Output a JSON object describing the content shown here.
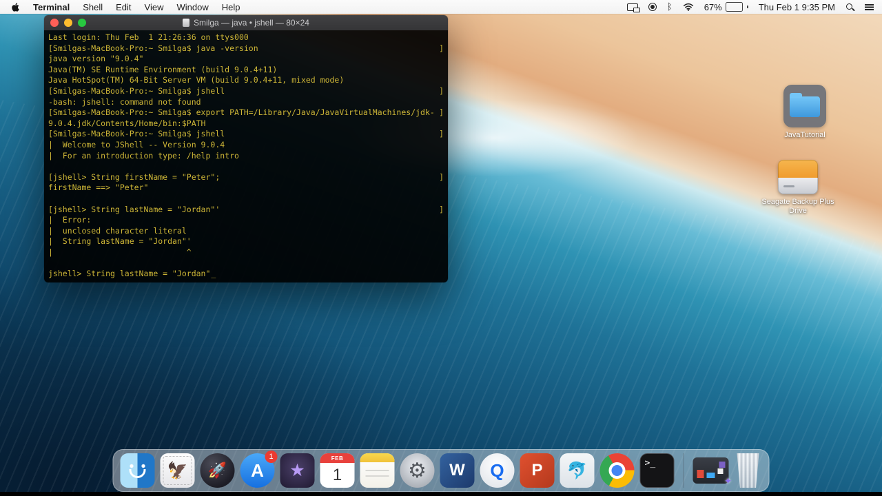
{
  "menu_bar": {
    "app_name": "Terminal",
    "items": [
      "Shell",
      "Edit",
      "View",
      "Window",
      "Help"
    ],
    "battery": "67%",
    "clock": "Thu Feb 1  9:35 PM"
  },
  "terminal": {
    "title": "Smilga — java • jshell — 80×24",
    "lines": [
      {
        "text": "Last login: Thu Feb  1 21:26:36 on ttys000"
      },
      {
        "text": "[Smilgas-MacBook-Pro:~ Smilga$ java -version",
        "mark": "]"
      },
      {
        "text": "java version \"9.0.4\""
      },
      {
        "text": "Java(TM) SE Runtime Environment (build 9.0.4+11)"
      },
      {
        "text": "Java HotSpot(TM) 64-Bit Server VM (build 9.0.4+11, mixed mode)"
      },
      {
        "text": "[Smilgas-MacBook-Pro:~ Smilga$ jshell",
        "mark": "]"
      },
      {
        "text": "-bash: jshell: command not found"
      },
      {
        "text": "[Smilgas-MacBook-Pro:~ Smilga$ export PATH=/Library/Java/JavaVirtualMachines/jdk-",
        "mark": "]"
      },
      {
        "text": "9.0.4.jdk/Contents/Home/bin:$PATH"
      },
      {
        "text": "[Smilgas-MacBook-Pro:~ Smilga$ jshell",
        "mark": "]"
      },
      {
        "text": "|  Welcome to JShell -- Version 9.0.4"
      },
      {
        "text": "|  For an introduction type: /help intro"
      },
      {
        "text": ""
      },
      {
        "text": "[jshell> String firstName = \"Peter\";",
        "mark": "]"
      },
      {
        "text": "firstName ==> \"Peter\""
      },
      {
        "text": ""
      },
      {
        "text": "[jshell> String lastName = \"Jordan\"'",
        "mark": "]"
      },
      {
        "text": "|  Error:"
      },
      {
        "text": "|  unclosed character literal"
      },
      {
        "text": "|  String lastName = \"Jordan\"'"
      },
      {
        "text": "|                            ^"
      },
      {
        "text": ""
      },
      {
        "text": "jshell> String lastName = \"Jordan\"",
        "cursor": true
      }
    ]
  },
  "desktop_icons": [
    {
      "name": "javatutorial-folder",
      "type": "folder",
      "label": "JavaTutorial"
    },
    {
      "name": "seagate-drive",
      "type": "drive",
      "label": "Seagate Backup Plus Drive"
    }
  ],
  "dock": {
    "items": [
      {
        "name": "finder",
        "label": "Finder"
      },
      {
        "name": "mail",
        "label": "Mail",
        "glyph": "🦅"
      },
      {
        "name": "launchpad",
        "label": "Launchpad",
        "glyph": "🚀"
      },
      {
        "name": "appstore",
        "label": "App Store",
        "text": "A",
        "badge": "1"
      },
      {
        "name": "imovie",
        "label": "iMovie",
        "text": "★"
      },
      {
        "name": "calendar",
        "label": "Calendar",
        "month": "FEB",
        "day": "1"
      },
      {
        "name": "notes",
        "label": "Notes"
      },
      {
        "name": "system-preferences",
        "label": "System Preferences",
        "glyph": "⚙"
      },
      {
        "name": "word",
        "label": "Microsoft Word",
        "text": "W"
      },
      {
        "name": "quicktime",
        "label": "QuickTime Player",
        "text": "Q"
      },
      {
        "name": "powerpoint",
        "label": "Microsoft PowerPoint",
        "text": "P"
      },
      {
        "name": "mysql",
        "label": "MySQL Workbench",
        "glyph": "🐬"
      },
      {
        "name": "chrome",
        "label": "Google Chrome"
      },
      {
        "name": "terminal-app",
        "label": "Terminal",
        "text": ">_"
      },
      {
        "name": "separator",
        "type": "separator"
      },
      {
        "name": "minimized-window",
        "label": "Minimized Window",
        "badge_glyph": "✦"
      },
      {
        "name": "trash",
        "label": "Trash"
      }
    ]
  },
  "colors": {
    "terminal_text": "#cdb637",
    "titlebar": "#3a3a3c",
    "traffic_red": "#ff5f57",
    "traffic_yellow": "#febc2e",
    "traffic_green": "#28c840",
    "badge_red": "#ec3b31"
  }
}
